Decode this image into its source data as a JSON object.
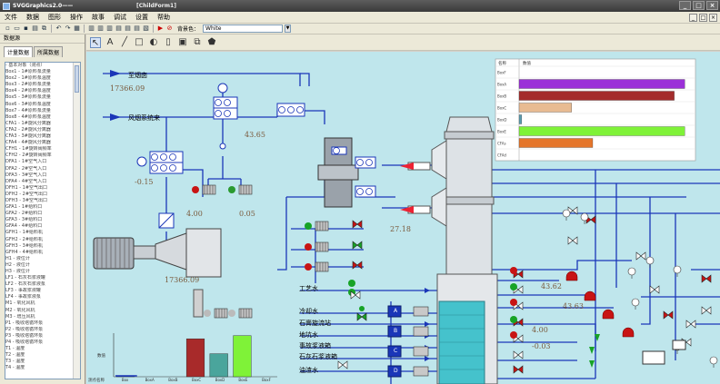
{
  "window": {
    "app_title": "SVGGraphics2.0——",
    "doc_title": "[ChildForm1]",
    "buttons": [
      "_",
      "□",
      "×"
    ]
  },
  "menu": [
    "文件",
    "数据",
    "图形",
    "操作",
    "故事",
    "调试",
    "设置",
    "帮助"
  ],
  "toolbar": {
    "icons": [
      "new-icon",
      "open-icon",
      "save-icon",
      "print-icon",
      "copy-icon",
      "paste-icon",
      "undo-icon",
      "redo-icon",
      "grid-icon",
      "align-icon",
      "align-icon",
      "align-icon",
      "align-icon",
      "align-icon",
      "align-icon",
      "align-icon",
      "run-icon",
      "stop-icon"
    ],
    "combo_label": "背景色：",
    "combo_value": "White"
  },
  "left_panel": {
    "title": "数据源",
    "tabs": [
      "计量数据",
      "所属数据"
    ],
    "tree": [
      "- 基本对象（测点）",
      "  Box1 - 1#原料泵流量",
      "  Box2 - 1#原料泵温度",
      "  Box3 - 2#原料泵流量",
      "  Box4 - 2#原料泵温度",
      "  Box5 - 3#原料泵流量",
      "  Box6 - 3#原料泵温度",
      "  Box7 - 4#原料泵流量",
      "  Box8 - 4#原料泵温度",
      "  CFA1 - 1#旋风分离器",
      "  CFA2 - 2#旋风分离器",
      "  CFA3 - 3#旋风分离器",
      "  CFA4 - 4#旋风分离器",
      "  CFH1 - 1#旋转阀频率",
      "  CFH2 - 2#旋转阀频率",
      "  DFA1 - 1#空气入口",
      "  DFA2 - 2#空气入口",
      "  DFA3 - 3#空气入口",
      "  DFA4 - 4#空气入口",
      "  DFH1 - 1#空气出口",
      "  DFH2 - 2#空气出口",
      "  DFH3 - 3#空气出口",
      "  GFA1 - 1#给料口",
      "  GFA2 - 2#给料口",
      "  GFA3 - 3#给料口",
      "  GFA4 - 4#给料口",
      "  GFH1 - 1#给料机",
      "  GFH2 - 2#给料机",
      "  GFH3 - 3#给料机",
      "  GFH4 - 4#给料机",
      "  H1 - 液位计",
      "  H2 - 液位计",
      "  H3 - 液位计",
      "  LF1 - 石灰石浆液罐",
      "  LF2 - 石灰石浆液泵",
      "  LF3 - 事故浆液罐",
      "  LF4 - 事故浆液泵",
      "  M1 - 氧化风机",
      "  M2 - 氧化风机",
      "  M3 - 增压风机",
      "  P1 - 吸收塔循环泵",
      "  P2 - 吸收塔循环泵",
      "  P3 - 吸收塔循环泵",
      "  P4 - 吸收塔循环泵",
      "  T1 - 温度",
      "  T2 - 温度",
      "  T3 - 温度",
      "  T4 - 温度"
    ]
  },
  "child_toolbar": {
    "icons": [
      "select-icon",
      "text-icon",
      "line-icon",
      "rect-icon",
      "circle-icon",
      "ellipse-icon",
      "image-icon",
      "group-icon",
      "shape-icon"
    ]
  },
  "canvas": {
    "labels": {
      "air_preheater": "至烟囱",
      "flue_system": "风烟系统来",
      "process_water": "工艺水",
      "cooling_water": "冷却水",
      "gypsum_station": "石膏旋流站",
      "pit_water": "地坑水",
      "emergency_tank": "事故浆液箱",
      "limestone_tank": "石灰石浆液箱",
      "oil_water": "油渣水"
    },
    "values": {
      "main_flow": "17366.09",
      "dp1": "43.65",
      "dp2": "-0.15",
      "fan_left": "4.00",
      "fan_right": "0.05",
      "booster_temp": "27.18",
      "booster_flow": "17366.09",
      "pump_a": "43.62",
      "pump_b": "43.63",
      "pump_c": "4.00",
      "pump_d": "-0.03"
    },
    "abc": [
      "A",
      "B",
      "C",
      "D"
    ]
  },
  "colors": {
    "pipe": "#1a36b8",
    "canvas_bg": "#bfe6ec",
    "valve_red": "#c81414",
    "valve_green": "#17a326"
  },
  "chart_data": [
    {
      "type": "bar",
      "orientation": "horizontal",
      "title": "",
      "header": [
        "名称",
        "数值"
      ],
      "categories": [
        "BoxF",
        "BoxA",
        "BoxB",
        "BoxC",
        "BoxD",
        "BoxE",
        "CFAs",
        "CFAd"
      ],
      "values": [
        0,
        63,
        59,
        20,
        1,
        63,
        28,
        0
      ],
      "colors": [
        "#9a9a9a",
        "#9b30d8",
        "#a42c2c",
        "#e8bb92",
        "#5a9cb0",
        "#7ff238",
        "#e4752a",
        "#9a9a9a"
      ],
      "xlim": [
        0,
        65
      ],
      "grid": true
    },
    {
      "type": "bar",
      "title": "",
      "ylabel": "数值",
      "xlabel": "测点名称",
      "categories": [
        "Box",
        "BoxA",
        "BoxB",
        "BoxC",
        "BoxD",
        "BoxE",
        "BoxF"
      ],
      "values": [
        1,
        0,
        0,
        61,
        37,
        66,
        0
      ],
      "colors": [
        "#1a36b8",
        "#1a36b8",
        "#1a36b8",
        "#a82a2a",
        "#4aa59c",
        "#7ff238",
        "#1a36b8"
      ],
      "ylim": [
        0,
        70
      ]
    }
  ]
}
